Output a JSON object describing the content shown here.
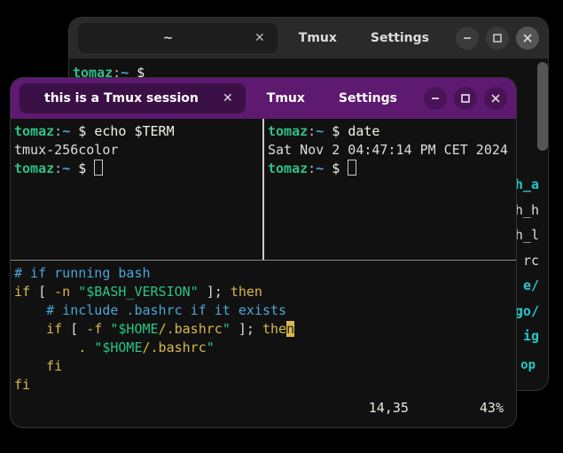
{
  "back_window": {
    "tab_title": "~",
    "buttons": {
      "tmux": "Tmux",
      "settings": "Settings"
    },
    "prompt": {
      "user": "tomaz",
      "path": "~",
      "symbol": "$"
    },
    "file_list": [
      "h_a",
      "h_h",
      "h_l",
      "rc",
      "e/",
      "go/",
      "ig",
      "op"
    ],
    "file_classes": [
      "cyan",
      "",
      "",
      "",
      "cyan",
      "cyan",
      "cyan",
      "cyan"
    ]
  },
  "front_window": {
    "tab_title": "this is a Tmux session",
    "buttons": {
      "tmux": "Tmux",
      "settings": "Settings"
    },
    "pane_left": {
      "prompt": {
        "user": "tomaz",
        "path": "~",
        "symbol": "$"
      },
      "command": "echo $TERM",
      "output": "tmux-256color"
    },
    "pane_right": {
      "prompt": {
        "user": "tomaz",
        "path": "~",
        "symbol": "$"
      },
      "command": "date",
      "output": "Sat Nov  2 04:47:14 PM CET 2024"
    },
    "editor_lines": [
      {
        "segments": [
          {
            "t": "# if running bash",
            "c": "cmt"
          }
        ]
      },
      {
        "segments": [
          {
            "t": "if",
            "c": "kw"
          },
          {
            "t": " [ ",
            "c": "var"
          },
          {
            "t": "-n",
            "c": "error"
          },
          {
            "t": " ",
            "c": "var"
          },
          {
            "t": "\"$BASH_VERSION\"",
            "c": "str"
          },
          {
            "t": " ]; ",
            "c": "var"
          },
          {
            "t": "then",
            "c": "kw"
          }
        ]
      },
      {
        "segments": [
          {
            "t": "    ",
            "c": "var"
          },
          {
            "t": "# include .bashrc if it exists",
            "c": "cmt"
          }
        ]
      },
      {
        "segments": [
          {
            "t": "    ",
            "c": "var"
          },
          {
            "t": "if",
            "c": "kw"
          },
          {
            "t": " [ ",
            "c": "var"
          },
          {
            "t": "-f",
            "c": "error"
          },
          {
            "t": " ",
            "c": "var"
          },
          {
            "t": "\"$HOME",
            "c": "str"
          },
          {
            "t": "/.bashrc",
            "c": "error"
          },
          {
            "t": "\"",
            "c": "str"
          },
          {
            "t": " ]; ",
            "c": "var"
          },
          {
            "t": "the",
            "c": "kw"
          },
          {
            "t": "n",
            "c": "hl"
          }
        ]
      },
      {
        "segments": [
          {
            "t": "        ",
            "c": "var"
          },
          {
            "t": ".",
            "c": "kw"
          },
          {
            "t": " ",
            "c": "var"
          },
          {
            "t": "\"$HOME",
            "c": "str"
          },
          {
            "t": "/.bashrc",
            "c": "error"
          },
          {
            "t": "\"",
            "c": "str"
          }
        ]
      },
      {
        "segments": [
          {
            "t": "    ",
            "c": "var"
          },
          {
            "t": "fi",
            "c": "kw"
          }
        ]
      },
      {
        "segments": [
          {
            "t": "fi",
            "c": "kw"
          }
        ]
      }
    ],
    "status": {
      "pos": "14,35",
      "pct": "43%"
    }
  }
}
